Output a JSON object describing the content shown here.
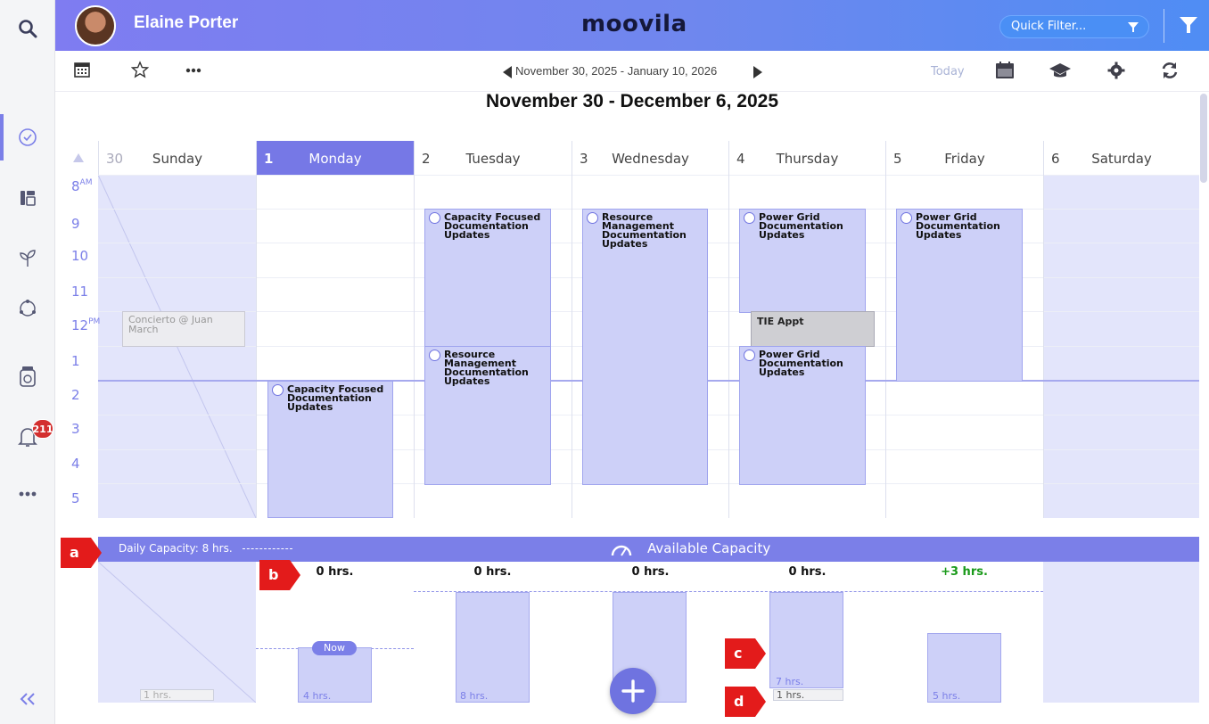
{
  "header": {
    "user_name": "Elaine Porter",
    "logo": "moovila",
    "quick_filter_placeholder": "Quick Filter..."
  },
  "toolbar": {
    "date_range": "November 30, 2025  -  January 10, 2026",
    "today": "Today"
  },
  "calendar": {
    "week_title": "November 30  -  December 6, 2025",
    "days": [
      {
        "num": "30",
        "name": "Sunday"
      },
      {
        "num": "1",
        "name": "Monday"
      },
      {
        "num": "2",
        "name": "Tuesday"
      },
      {
        "num": "3",
        "name": "Wednesday"
      },
      {
        "num": "4",
        "name": "Thursday"
      },
      {
        "num": "5",
        "name": "Friday"
      },
      {
        "num": "6",
        "name": "Saturday"
      }
    ],
    "hours": [
      "8",
      "9",
      "10",
      "11",
      "12",
      "1",
      "2",
      "3",
      "4",
      "5"
    ],
    "am": "AM",
    "pm": "PM",
    "events": {
      "sun_gray": "Concierto @ Juan March",
      "mon": "Capacity Focused Documentation Updates",
      "tue1": "Capacity Focused Documentation Updates",
      "tue2": "Resource Management Documentation Updates",
      "wed": "Resource Management Documentation Updates",
      "thu1": "Power Grid Documentation Updates",
      "thu_tie": "TIE Appt",
      "thu2": "Power Grid Documentation Updates",
      "fri": "Power Grid Documentation Updates"
    }
  },
  "capacity": {
    "daily": "Daily Capacity: 8 hrs.",
    "title": "Available Capacity",
    "values": [
      "0 hrs.",
      "0 hrs.",
      "0 hrs.",
      "0 hrs.",
      "+3 hrs."
    ],
    "now": "Now",
    "bar_labels": {
      "sun": "1 hrs.",
      "mon": "4 hrs.",
      "tue": "8 hrs.",
      "thu": "7 hrs.",
      "thu_small": "1 hrs.",
      "fri": "5 hrs."
    }
  },
  "sidebar": {
    "notifications_count": "211"
  },
  "annotations": [
    "a",
    "b",
    "c",
    "d"
  ]
}
